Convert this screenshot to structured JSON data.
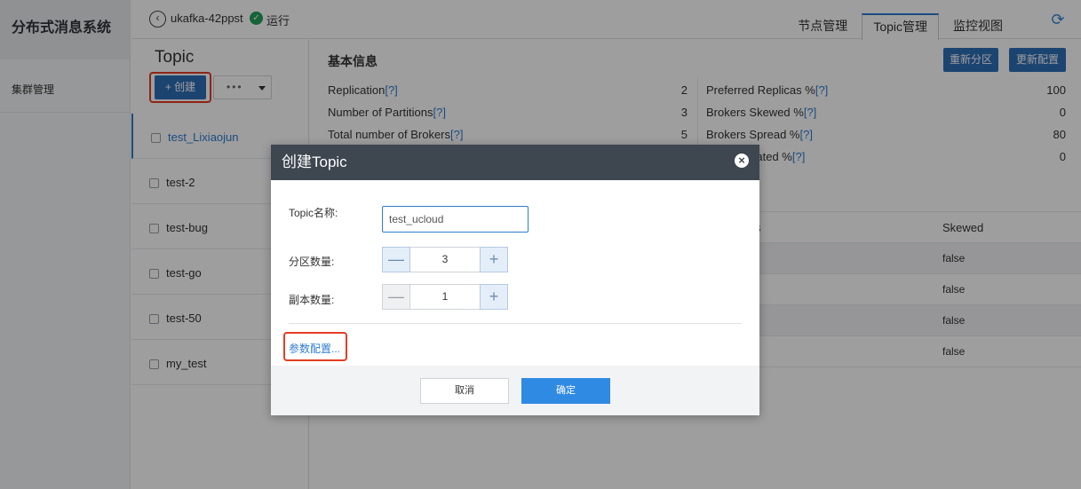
{
  "nav": {
    "title": "分布式消息系统",
    "items": [
      {
        "label": "集群管理"
      }
    ]
  },
  "topbar": {
    "instance": "ukafka-42ppst",
    "status": "运行",
    "tabs": [
      {
        "label": "节点管理",
        "active": false
      },
      {
        "label": "Topic管理",
        "active": true
      },
      {
        "label": "监控视图",
        "active": false
      }
    ]
  },
  "topics": {
    "heading": "Topic",
    "create_label": "+ 创建",
    "more_label": "•••",
    "items": [
      {
        "name": "test_Lixiaojun"
      },
      {
        "name": "test-2"
      },
      {
        "name": "test-bug"
      },
      {
        "name": "test-go"
      },
      {
        "name": "test-50"
      },
      {
        "name": "my_test"
      }
    ]
  },
  "main": {
    "heading": "基本信息",
    "repartition_label": "重新分区",
    "update_config_label": "更新配置",
    "q": "[?]",
    "left_info": [
      {
        "label": "Replication",
        "value": "2"
      },
      {
        "label": "Number of Partitions",
        "value": "3"
      },
      {
        "label": "Total number of Brokers",
        "value": "5"
      }
    ],
    "right_info": [
      {
        "label": "Preferred Replicas %",
        "value": "100"
      },
      {
        "label": "Brokers Skewed %",
        "value": "0"
      },
      {
        "label": "Brokers Spread %",
        "value": "80"
      },
      {
        "label": "icated %",
        "value": "0"
      }
    ],
    "table": {
      "headers": [
        "tions",
        "Skewed"
      ],
      "rows": [
        {
          "skewed": "false"
        },
        {
          "skewed": "false"
        },
        {
          "skewed": "false"
        },
        {
          "skewed": "false"
        }
      ]
    }
  },
  "modal": {
    "title": "创建Topic",
    "close_icon": "×",
    "name_label": "Topic名称:",
    "name_value": "test_ucloud",
    "partitions_label": "分区数量:",
    "partitions_value": "3",
    "replicas_label": "副本数量:",
    "replicas_value": "1",
    "minus": "—",
    "plus": "+",
    "param_link": "参数配置...",
    "cancel_label": "取消",
    "ok_label": "确定"
  }
}
